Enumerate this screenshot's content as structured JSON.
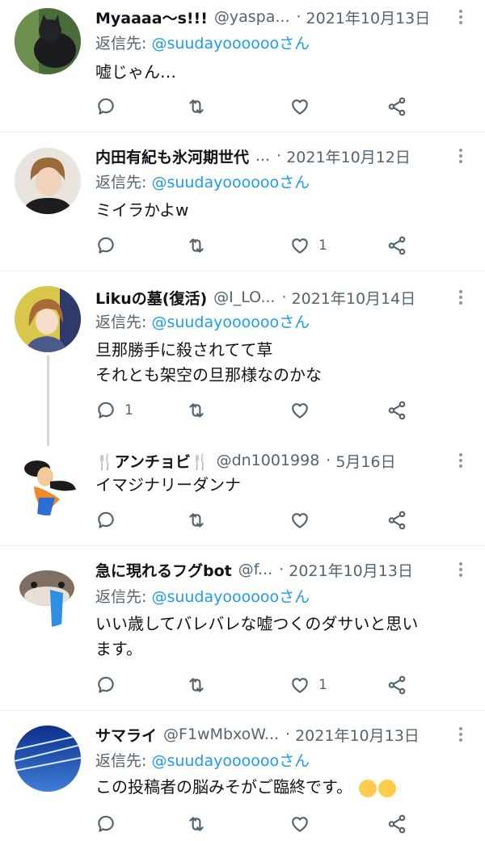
{
  "tweets": [
    {
      "name": "Myaaaa〜s!!!",
      "handle": "@yaspa...",
      "dot": "·",
      "time": "2021年10月13日",
      "reply_label": "返信先: ",
      "reply_user": "@suudayoooooo",
      "reply_suffix": "さん",
      "text": "嘘じゃん…",
      "likes": "",
      "replies": "",
      "avatar": "cat-photo"
    },
    {
      "name": "内田有紀も氷河期世代",
      "handle": "...",
      "dot": "·",
      "time": "2021年10月12日",
      "reply_label": "返信先: ",
      "reply_user": "@suudayoooooo",
      "reply_suffix": "さん",
      "text": "ミイラかよw",
      "likes": "1",
      "replies": "",
      "avatar": "woman-portrait"
    },
    {
      "name": "Likuの墓(復活)",
      "handle": "@I_LO...",
      "dot": "·",
      "time": "2021年10月14日",
      "reply_label": "返信先: ",
      "reply_user": "@suudayoooooo",
      "reply_suffix": "さん",
      "text": "旦那勝手に殺されてて草\nそれとも架空の旦那様なのかな",
      "likes": "",
      "replies": "1",
      "avatar": "anime-girl"
    },
    {
      "name": "🍴アンチョビ🍴",
      "handle": "@dn1001998",
      "dot": "·",
      "time": "5月16日",
      "text": "イマジナリーダンナ",
      "likes": "",
      "replies": "",
      "avatar": "goofy-cartoon"
    },
    {
      "name": "急に現れるフグbot",
      "handle": "@f...",
      "dot": "·",
      "time": "2021年10月13日",
      "reply_label": "返信先: ",
      "reply_user": "@suudayoooooo",
      "reply_suffix": "さん",
      "text": "いい歳してバレバレな嘘つくのダサいと思い\nます。",
      "likes": "1",
      "replies": "",
      "avatar": "pufferfish"
    },
    {
      "name": "サマライ",
      "handle": "@F1wMbxoW...",
      "dot": "·",
      "time": "2021年10月13日",
      "reply_label": "返信先: ",
      "reply_user": "@suudayoooooo",
      "reply_suffix": "さん",
      "text": "この投稿者の脳みそがご臨終です。",
      "emoji": [
        "rolling-laughing-emoji",
        "tears-of-joy-emoji"
      ],
      "likes": "",
      "replies": "",
      "avatar": "sky-contrails"
    }
  ],
  "icons": {
    "reply": "reply-icon",
    "retweet": "retweet-icon",
    "like": "heart-icon",
    "share": "share-icon",
    "more": "more-icon"
  },
  "colors": {
    "link": "#1d9bf0",
    "secondary_text": "#536471",
    "primary_text": "#0f1419",
    "divider": "#eff3f4",
    "thread_line": "#cfd9de"
  }
}
